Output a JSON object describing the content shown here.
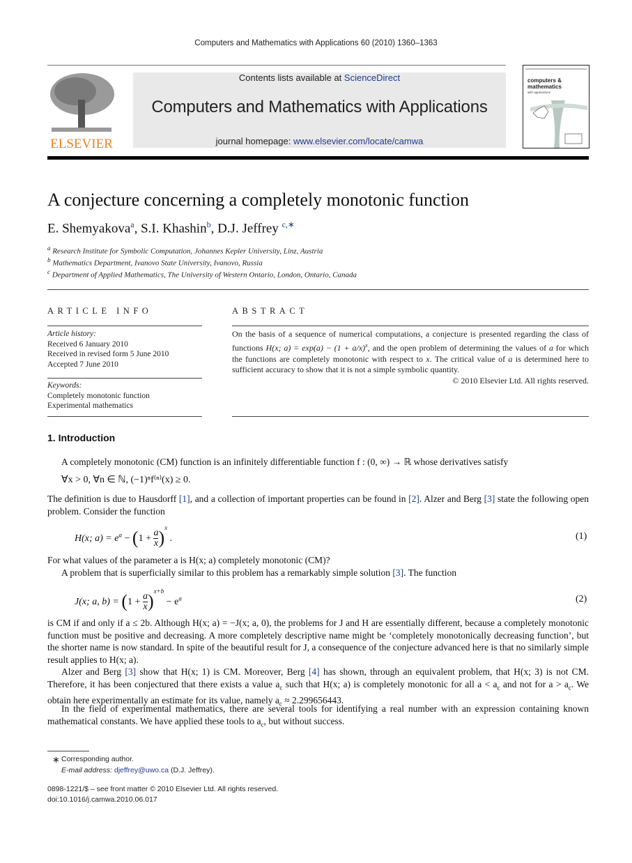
{
  "header": {
    "journal_reference": "Computers and Mathematics with Applications 60 (2010) 1360–1363",
    "contents_prefix": "Contents lists available at ",
    "contents_link": "ScienceDirect",
    "journal_title": "Computers and Mathematics with Applications",
    "homepage_prefix": "journal homepage: ",
    "homepage_link": "www.elsevier.com/locate/camwa",
    "publisher_logo_text": "ELSEVIER",
    "cover": {
      "line1": "computers &",
      "line2": "mathematics",
      "line3": "with applications"
    }
  },
  "article": {
    "title": "A conjecture concerning a completely monotonic function",
    "authors": [
      {
        "name": "E. Shemyakova",
        "affil": "a"
      },
      {
        "name": "S.I. Khashin",
        "affil": "b"
      },
      {
        "name": "D.J. Jeffrey",
        "affil": "c,∗"
      }
    ],
    "affiliations": [
      {
        "key": "a",
        "text": "Research Institute for Symbolic Computation, Johannes Kepler University, Linz, Austria"
      },
      {
        "key": "b",
        "text": "Mathematics Department, Ivanovo State University, Ivanovo, Russia"
      },
      {
        "key": "c",
        "text": "Department of Applied Mathematics, The University of Western Ontario, London, Ontario, Canada"
      }
    ]
  },
  "article_info": {
    "heading": "ARTICLE INFO",
    "history_label": "Article history:",
    "history": [
      "Received 6 January 2010",
      "Received in revised form 5 June 2010",
      "Accepted 7 June 2010"
    ],
    "keywords_label": "Keywords:",
    "keywords": [
      "Completely monotonic function",
      "Experimental mathematics"
    ]
  },
  "abstract": {
    "heading": "ABSTRACT",
    "text_1": "On the basis of a sequence of numerical computations, a conjecture is presented regarding the class of functions ",
    "formula": "H(x; a) = exp(a) − (1 + a/x)",
    "formula_exp": "x",
    "text_2": ", and the open problem of determining the values of ",
    "text_3": " for which the functions are completely monotonic with respect to ",
    "text_4": ". The critical value of ",
    "text_5": " is determined here to sufficient accuracy to show that it is not a simple symbolic quantity.",
    "copyright": "© 2010 Elsevier Ltd. All rights reserved."
  },
  "intro": {
    "heading": "1.  Introduction",
    "p1": "A completely monotonic (CM) function is an infinitely differentiable function f : (0, ∞) → ℝ whose derivatives satisfy",
    "display1": "∀x > 0, ∀n ∈ ℕ,    (−1)ⁿf⁽ⁿ⁾(x) ≥ 0.",
    "p2_a": "The definition is due to Hausdorff ",
    "p2_b": ", and a collection of important properties can be found in ",
    "p2_c": ". Alzer and Berg ",
    "p2_d": " state the following open problem. Consider the function",
    "ref1": "[1]",
    "ref2": "[2]",
    "ref3": "[3]",
    "ref4": "[4]",
    "eq1_lhs": "H(x; a) = e",
    "eq1_rest": " − ",
    "eq1_num": "(1)",
    "p3": "For what values of the parameter a is H(x; a) completely monotonic (CM)?",
    "p4_a": "A problem that is superficially similar to this problem has a remarkably simple solution ",
    "p4_b": ". The function",
    "eq2_lhs": "J(x; a, b) = ",
    "eq2_exp": "x+b",
    "eq2_num": "(2)",
    "p5": "is CM if and only if a ≤ 2b. Although H(x; a) = −J(x; a, 0), the problems for J and H are essentially different, because a completely monotonic function must be positive and decreasing. A more completely descriptive name might be ‘completely monotonically decreasing function’, but the shorter name is now standard. In spite of the beautiful result for J, a consequence of the conjecture advanced here is that no similarly simple result applies to H(x; a).",
    "p6_a": "Alzer and Berg ",
    "p6_b": " show that H(x; 1) is CM. Moreover, Berg ",
    "p6_c": " has shown, through an equivalent problem, that H(x; 3) is not CM. Therefore, it has been conjectured that there exists a value a",
    "p6_d": " such that H(x; a) is completely monotonic for all a < a",
    "p6_e": " and not for a > a",
    "p6_f": ". We obtain here experimentally an estimate for its value, namely a",
    "p6_g": " ≈ 2.299656443.",
    "sub_c": "c",
    "p7_a": "In the field of experimental mathematics, there are several tools for identifying a real number with an expression containing known mathematical constants. We have applied these tools to a",
    "p7_b": ", but without success."
  },
  "footnotes": {
    "star": "∗",
    "corresponding": "Corresponding author.",
    "email_label": "E-mail address: ",
    "email": "djeffrey@uwo.ca",
    "email_owner": " (D.J. Jeffrey).",
    "front_matter": "0898-1221/$ – see front matter © 2010 Elsevier Ltd. All rights reserved.",
    "doi": "doi:10.1016/j.camwa.2010.06.017"
  }
}
